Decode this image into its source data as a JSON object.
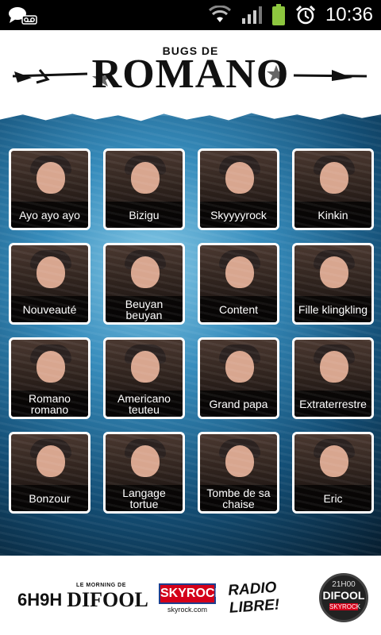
{
  "status_bar": {
    "time": "10:36",
    "icons": [
      "chat-notification-icon",
      "voicemail-icon",
      "wifi-icon",
      "signal-icon",
      "battery-icon",
      "alarm-icon"
    ]
  },
  "header": {
    "logo_top": "BUGS DE",
    "logo_main": "ROMANO"
  },
  "tiles": [
    {
      "label": "Ayo ayo ayo"
    },
    {
      "label": "Bizigu"
    },
    {
      "label": "Skyyyyrock"
    },
    {
      "label": "Kinkin"
    },
    {
      "label": "Nouveauté"
    },
    {
      "label": "Beuyan\nbeuyan"
    },
    {
      "label": "Content"
    },
    {
      "label": "Fille klingkling"
    },
    {
      "label": "Romano\nromano"
    },
    {
      "label": "Americano\nteuteu"
    },
    {
      "label": "Grand papa"
    },
    {
      "label": "Extraterrestre"
    },
    {
      "label": "Bonzour"
    },
    {
      "label": "Langage\ntortue"
    },
    {
      "label": "Tombe de sa\nchaise"
    },
    {
      "label": "Eric"
    }
  ],
  "footer": {
    "difool_small": "LE MORNING DE",
    "difool_time": "6H9H",
    "difool_name": "DIFOOL",
    "skyrock": "SKYROCK",
    "skyrock_url": "skyrock.com",
    "radio_libre": "RADIO LIBRE!",
    "badge_time": "21H00",
    "badge_name": "DIFOOL",
    "badge_sub": "SKYROCK"
  },
  "colors": {
    "tile_border": "#ffffff",
    "label_bg": "#000000",
    "sky_red": "#d4001a",
    "sky_blue": "#1d3f8f"
  }
}
